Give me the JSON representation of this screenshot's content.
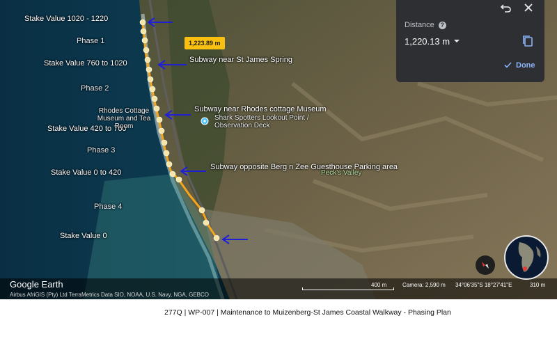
{
  "stake_labels": {
    "s1020": "Stake Value 1020 - 1220",
    "s760": "Stake Value 760 to 1020",
    "s420": "Stake Value 420 to 760",
    "s0_420": "Stake Value 0 to 420",
    "s0": "Stake Value 0"
  },
  "phase_labels": {
    "p1": "Phase 1",
    "p2": "Phase 2",
    "p3": "Phase 3",
    "p4": "Phase 4"
  },
  "subway_labels": {
    "spring": "Subway near St James Spring",
    "rhodes": "Subway near Rhodes cottage Museum",
    "bergnzee": "Subway opposite Berg n Zee Guesthouse Parking area"
  },
  "pois": {
    "rhodes_cottage": "Rhodes Cottage Museum and Tea Room",
    "shark_spotters": "Shark Spotters Lookout Point / Observation Deck",
    "pecks_valley": "Peck's Valley"
  },
  "path_callout": "1,223.89 m",
  "measure_panel": {
    "title": "Distance",
    "help_icon": "?",
    "value": "1,220.13 m",
    "done_label": "Done",
    "icons": [
      "undo-icon",
      "close-icon",
      "help-icon",
      "dropdown-caret-icon",
      "copy-icon",
      "check-icon"
    ]
  },
  "footer": {
    "logo": "Google Earth",
    "attribution": "Airbus  AfriGIS (Pty) Ltd  TerraMetrics  Data SIO, NOAA, U.S. Navy, NGA, GEBCO",
    "scale": "400 m",
    "camera": "Camera: 2,590 m",
    "coordinates": "34°06'35\"S 18°27'41\"E",
    "elevation": "310 m"
  },
  "caption": "277Q | WP-007 | Maintenance to Muizenberg-St James Coastal Walkway - Phasing Plan",
  "colors": {
    "ocean": "#0d3a4f",
    "land": "#6b6348",
    "path": "#f3a61c",
    "marker": "#f6e6a6",
    "arrow": "#1f1fd6",
    "panel": "#2d2f33",
    "accent": "#8ab4f8",
    "callout": "#f9c00f"
  }
}
